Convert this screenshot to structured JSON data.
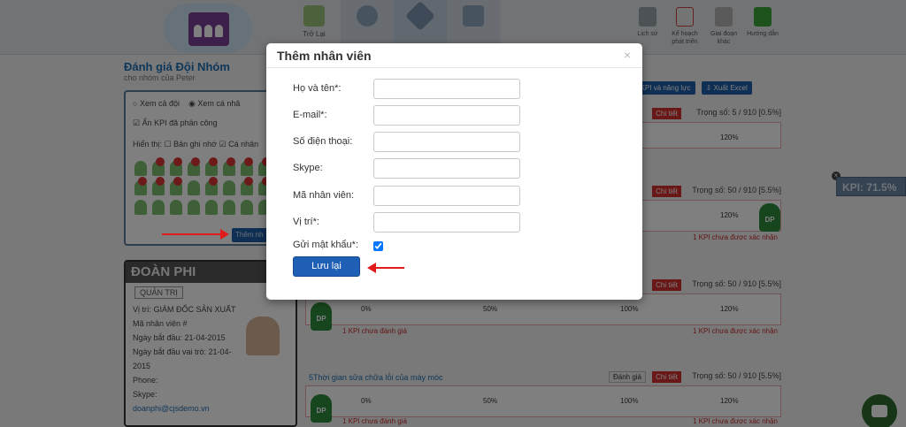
{
  "topbar": {
    "nav": [
      {
        "label": "Trở Lại",
        "icon": "back-icon"
      },
      {
        "label": "",
        "icon": "award-icon"
      },
      {
        "label": "",
        "icon": "rocket-icon"
      },
      {
        "label": "",
        "icon": "monitor-icon"
      }
    ],
    "right": [
      {
        "label": "Lịch sử",
        "icon": "history-icon"
      },
      {
        "label": "Kế hoạch phát triển",
        "icon": "plan-icon"
      },
      {
        "label": "Giai đoạn khác",
        "icon": "cabinet-icon"
      },
      {
        "label": "Hướng dẫn",
        "icon": "play-icon"
      }
    ]
  },
  "page": {
    "title": "Đánh giá Đội Nhóm",
    "subtitle": "cho nhóm của Peter"
  },
  "filter": {
    "view_all": "Xem cả đội",
    "view_one": "Xem cá nhâ",
    "hide_assigned": "Ẩn KPI đã phân công",
    "show_label": "Hiển thị:",
    "notes": "Bản ghi nhớ",
    "personal": "Cá nhân",
    "add_member": "Thêm nh"
  },
  "profile": {
    "name": "ĐOÀN PHI",
    "tab": "QUẢN TRỊ",
    "lines": [
      "Vị trí: GIÁM ĐỐC SẢN XUẤT",
      "Mã nhân viên #",
      "Ngày bắt đầu: 21-04-2015",
      "Ngày bắt đầu vai trò: 21-04-2015",
      "Phone:",
      "Skype:",
      "doanphi@cjsdemo.vn"
    ]
  },
  "actions": {
    "copy_kpi": "hép KPI và năng lực",
    "export_excel": "Xuất Excel"
  },
  "kpis": [
    {
      "weight": "Trọng số: 5 / 910 [0.5%]",
      "detail": "Chi tiết",
      "grade": "",
      "title": "",
      "scale": [
        "",
        "",
        "",
        "120%"
      ],
      "note_left": "",
      "note_right": ""
    },
    {
      "weight": "Trọng số: 50 / 910 [5.5%]",
      "detail": "Chi tiết",
      "grade": "",
      "title": "",
      "scale": [
        "",
        "",
        "",
        "120%"
      ],
      "note_left": "",
      "note_right": "1 KPI chưa được xác nhận"
    },
    {
      "weight": "Trọng số: 50 / 910 [5.5%]",
      "detail": "Chi tiết",
      "grade": "",
      "title": "",
      "scale": [
        "0%",
        "50%",
        "100%",
        "120%"
      ],
      "note_left": "1 KPI chưa đánh giá",
      "note_right": "1 KPI chưa được xác nhận"
    },
    {
      "weight": "Trọng số: 50 / 910 [5.5%]",
      "detail": "Chi tiết",
      "grade": "Đánh giá",
      "title": "5Thời gian sửa chữa lỗi của máy móc",
      "scale": [
        "0%",
        "50%",
        "100%",
        "120%"
      ],
      "note_left": "1 KPI chưa đánh giá",
      "note_right": "1 KPI chưa được xác nhận"
    }
  ],
  "kpi_float": "KPI: 71.5%",
  "modal": {
    "title": "Thêm nhân viên",
    "close": "×",
    "fields": [
      {
        "label": "Họ và tên*:",
        "value": "",
        "placeholder": ""
      },
      {
        "label": "E-mail*:",
        "value": "",
        "placeholder": ""
      },
      {
        "label": "Số điện thoại:",
        "value": "",
        "placeholder": ""
      },
      {
        "label": "Skype:",
        "value": "",
        "placeholder": ""
      },
      {
        "label": "Mã nhân viên:",
        "value": "",
        "placeholder": ""
      },
      {
        "label": "Vị trí*:",
        "value": "",
        "placeholder": ""
      }
    ],
    "send_password": {
      "label": "Gửi mật khẩu*:",
      "checked": true
    },
    "save_label": "Lưu lại"
  },
  "colors": {
    "primary": "#1f5fb5",
    "danger": "#d32f2f",
    "annotation_arrow": "#e11b1b"
  }
}
